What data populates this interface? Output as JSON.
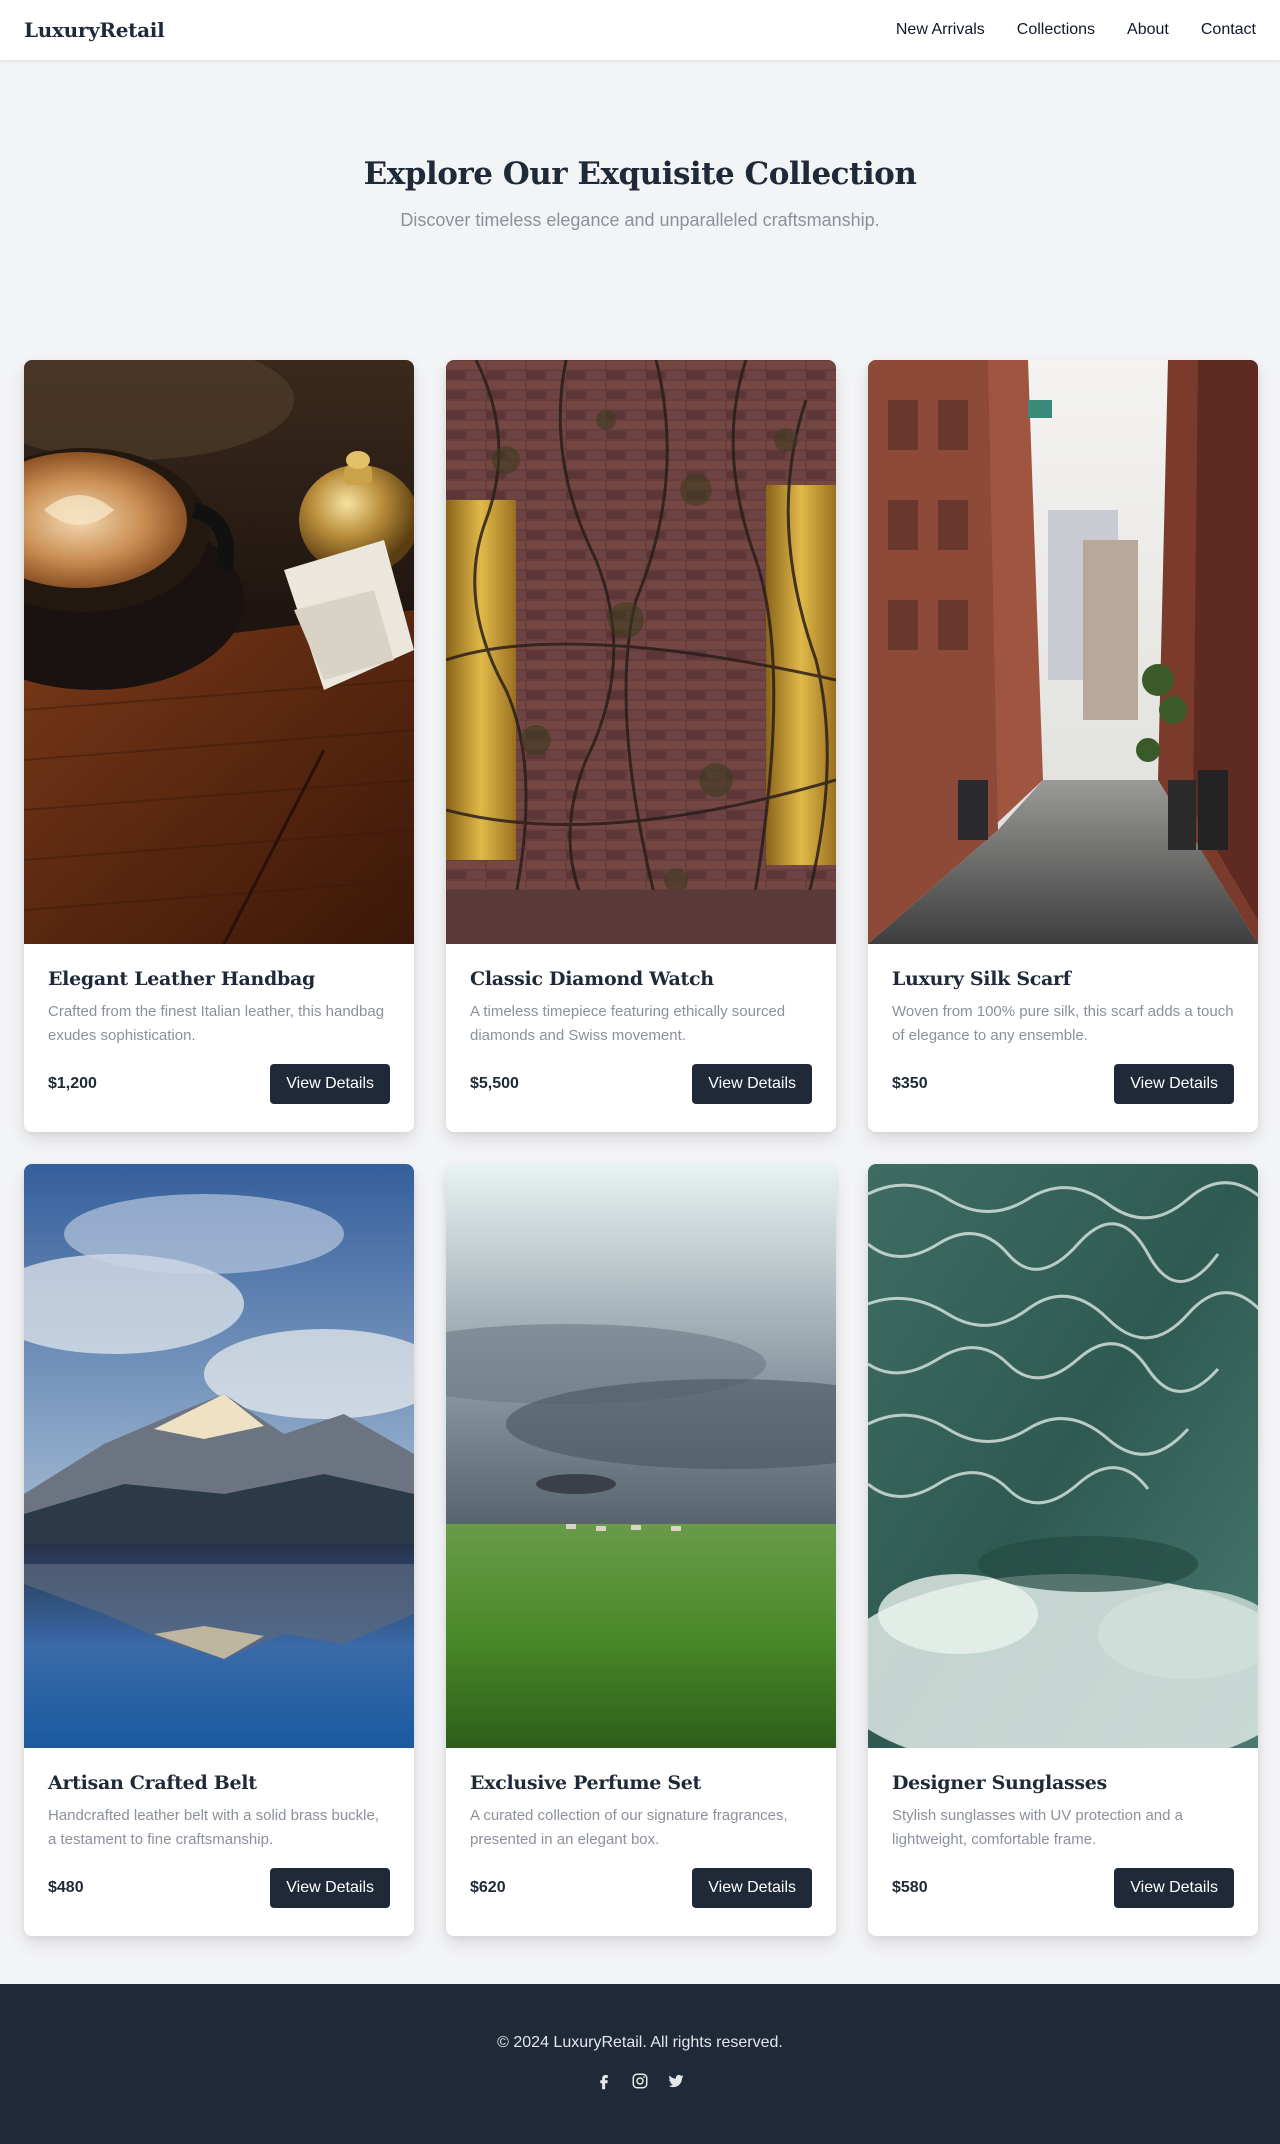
{
  "header": {
    "logo": "LuxuryRetail",
    "nav": [
      "New Arrivals",
      "Collections",
      "About",
      "Contact"
    ]
  },
  "hero": {
    "title": "Explore Our Exquisite Collection",
    "subtitle": "Discover timeless elegance and unparalleled craftsmanship."
  },
  "products": [
    {
      "title": "Elegant Leather Handbag",
      "description": "Crafted from the finest Italian leather, this handbag exudes sophistication.",
      "price": "$1,200",
      "button": "View Details",
      "image": "photo-coffee-cup-and-brass-bell"
    },
    {
      "title": "Classic Diamond Watch",
      "description": "A timeless timepiece featuring ethically sourced diamonds and Swiss movement.",
      "price": "$5,500",
      "button": "View Details",
      "image": "photo-brick-wall-with-vines"
    },
    {
      "title": "Luxury Silk Scarf",
      "description": "Woven from 100% pure silk, this scarf adds a touch of elegance to any ensemble.",
      "price": "$350",
      "button": "View Details",
      "image": "photo-city-alley"
    },
    {
      "title": "Artisan Crafted Belt",
      "description": "Handcrafted leather belt with a solid brass buckle, a testament to fine craftsmanship.",
      "price": "$480",
      "button": "View Details",
      "image": "photo-mountain-lake-reflection"
    },
    {
      "title": "Exclusive Perfume Set",
      "description": "A curated collection of our signature fragrances, presented in an elegant box.",
      "price": "$620",
      "button": "View Details",
      "image": "photo-stormy-sky-over-field"
    },
    {
      "title": "Designer Sunglasses",
      "description": "Stylish sunglasses with UV protection and a lightweight, comfortable frame.",
      "price": "$580",
      "button": "View Details",
      "image": "photo-ocean-waves"
    }
  ],
  "footer": {
    "copyright": "© 2024 LuxuryRetail. All rights reserved.",
    "socials": [
      "facebook-icon",
      "instagram-icon",
      "twitter-icon"
    ]
  },
  "colors": {
    "page_bg": "#f3f4f6",
    "primary": "#1f2937",
    "muted_text": "#8b919b",
    "card_bg": "#ffffff"
  }
}
